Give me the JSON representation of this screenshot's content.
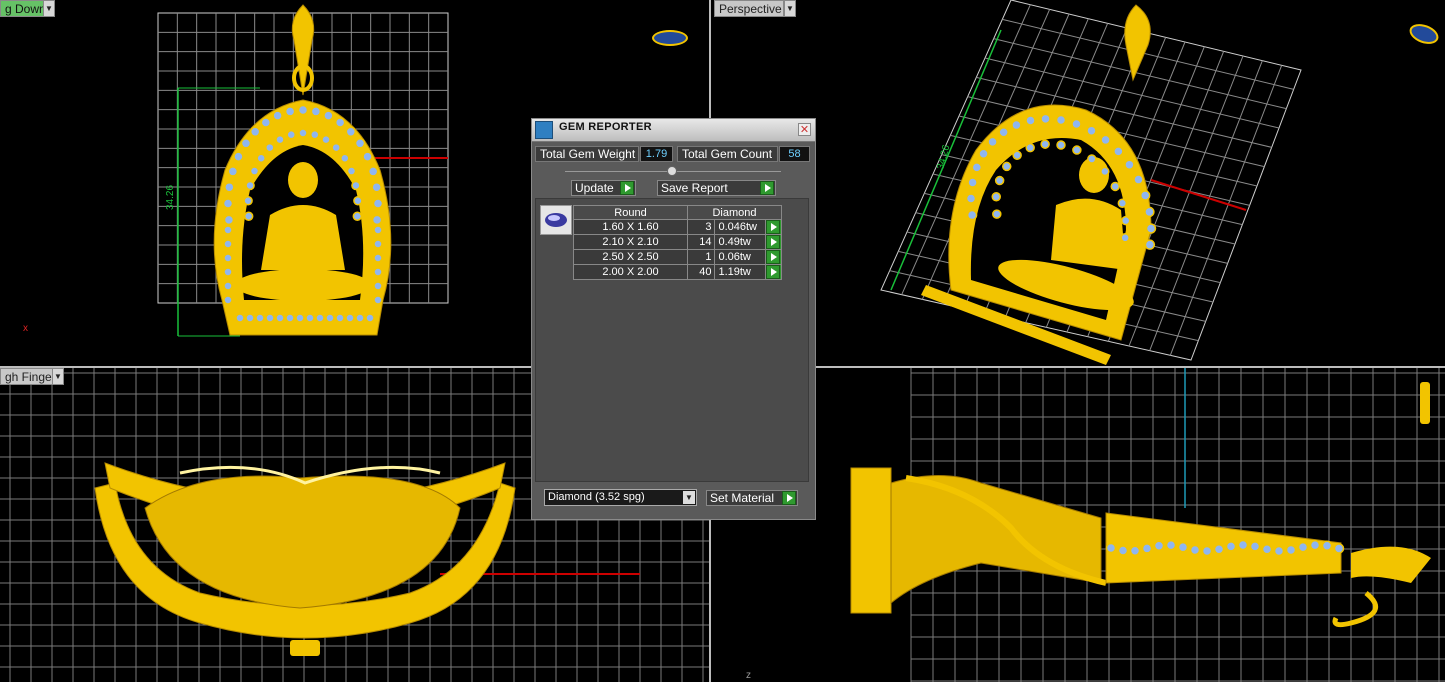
{
  "viewports": {
    "top_left": {
      "label": "g Down",
      "dimension": "34.26"
    },
    "top_right": {
      "label": "Perspective",
      "dimension": "34.26"
    },
    "bottom_left": {
      "label": "gh Finger"
    },
    "bottom_right": {},
    "axis_x": "x",
    "axis_z": "z"
  },
  "gem_reporter": {
    "title": "GEM REPORTER",
    "close": "✕",
    "total_weight_label": "Total Gem Weight",
    "total_weight_value": "1.79",
    "total_count_label": "Total Gem Count",
    "total_count_value": "58",
    "update_label": "Update",
    "save_report_label": "Save Report",
    "table": {
      "headers": [
        "Round",
        "Diamond"
      ],
      "rows": [
        {
          "size": "1.60 X 1.60",
          "count": "3",
          "weight": "0.046tw"
        },
        {
          "size": "2.10 X 2.10",
          "count": "14",
          "weight": "0.49tw"
        },
        {
          "size": "2.50 X 2.50",
          "count": "1",
          "weight": "0.06tw"
        },
        {
          "size": "2.00 X 2.00",
          "count": "40",
          "weight": "1.19tw"
        }
      ]
    },
    "material_select": "Diamond      (3.52 spg)",
    "set_material_label": "Set Material"
  },
  "colors": {
    "gold": "#f2c400",
    "gem_blue": "#8fb6f0",
    "grid": "#8a8a8a",
    "dim_green": "#19c03a",
    "value_cyan": "#6fd0ff"
  }
}
